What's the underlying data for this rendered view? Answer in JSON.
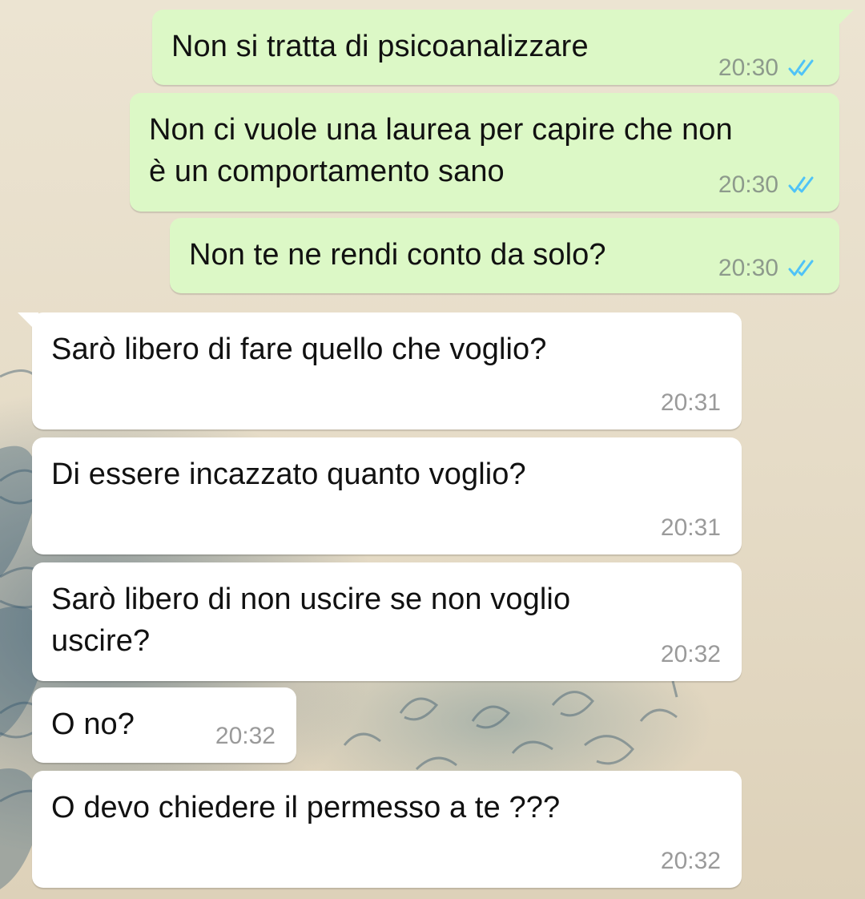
{
  "messages": [
    {
      "direction": "outgoing",
      "text": "Non si tratta di psicoanalizzare",
      "time": "20:30",
      "status_icon": "double-check-read-icon"
    },
    {
      "direction": "outgoing",
      "text": "Non ci vuole una laurea per capire che non\nè un comportamento sano",
      "time": "20:30",
      "status_icon": "double-check-read-icon"
    },
    {
      "direction": "outgoing",
      "text": "Non te ne rendi conto da solo?",
      "time": "20:30",
      "status_icon": "double-check-read-icon"
    },
    {
      "direction": "incoming",
      "text": "Sarò libero di fare quello che voglio?",
      "time": "20:31"
    },
    {
      "direction": "incoming",
      "text": "Di essere incazzato quanto voglio?",
      "time": "20:31"
    },
    {
      "direction": "incoming",
      "text": "Sarò libero di non uscire se non voglio\nuscire?",
      "time": "20:32"
    },
    {
      "direction": "incoming",
      "text": "O no?",
      "time": "20:32"
    },
    {
      "direction": "incoming",
      "text": "O devo chiedere il permesso a te ???",
      "time": "20:32"
    }
  ],
  "colors": {
    "outgoing_bubble": "#dcf8c6",
    "incoming_bubble": "#ffffff",
    "read_ticks": "#4fc3f7",
    "timestamp": "#8d9a8c"
  }
}
